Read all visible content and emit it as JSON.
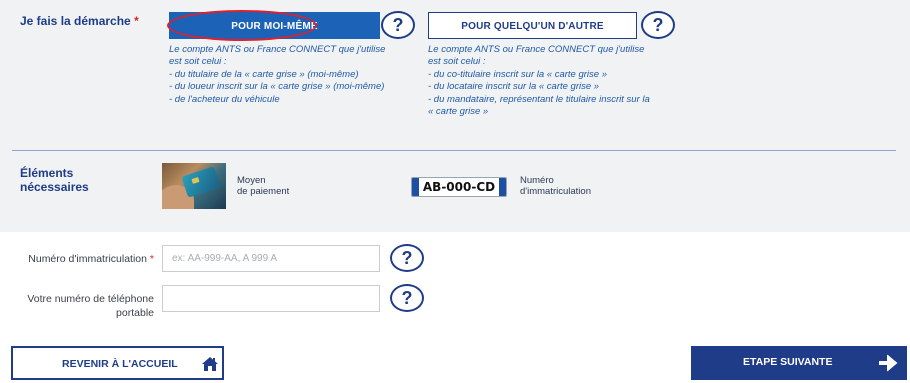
{
  "demarche": {
    "label": "Je fais la démarche",
    "required_mark": "*",
    "option_self": {
      "button_label": "POUR MOI-MÊME",
      "help_label": "?",
      "description": [
        "Le compte ANTS ou France CONNECT que j'utilise",
        "est soit celui :",
        "- du titulaire de la « carte grise » (moi-même)",
        "- du loueur inscrit sur la « carte grise » (moi-même)",
        "- de l'acheteur du véhicule"
      ]
    },
    "option_other": {
      "button_label": "POUR QUELQU'UN D'AUTRE",
      "help_label": "?",
      "description": [
        "Le compte ANTS ou France CONNECT que j'utilise",
        "est soit celui :",
        "- du co-titulaire inscrit sur la « carte grise »",
        "- du locataire inscrit sur la « carte grise »",
        "- du mandataire, représentant le titulaire inscrit sur la",
        "« carte grise »"
      ]
    }
  },
  "elements": {
    "label_line1": "Éléments",
    "label_line2": "nécessaires",
    "payment": {
      "line1": "Moyen",
      "line2": "de paiement"
    },
    "plate": {
      "text": "AB-000-CD",
      "line1": "Numéro",
      "line2": "d'immatriculation"
    }
  },
  "form": {
    "immatriculation": {
      "label": "Numéro d'immatriculation",
      "required_mark": "*",
      "placeholder": "ex: AA-999-AA, A 999 A",
      "value": "",
      "help_label": "?"
    },
    "telephone": {
      "label_line1": "Votre numéro de téléphone",
      "label_line2": "portable",
      "value": "",
      "help_label": "?"
    }
  },
  "footer": {
    "back_label": "REVENIR À L'ACCUEIL",
    "next_label": "ETAPE SUIVANTE"
  },
  "icons": {
    "back_icon": "home-icon",
    "next_icon": "arrow-right-icon"
  },
  "colors": {
    "primary_blue": "#1c63b8",
    "navy": "#1f3c88",
    "required_red": "#e0202a",
    "panel_gray": "#f1f2f3"
  }
}
